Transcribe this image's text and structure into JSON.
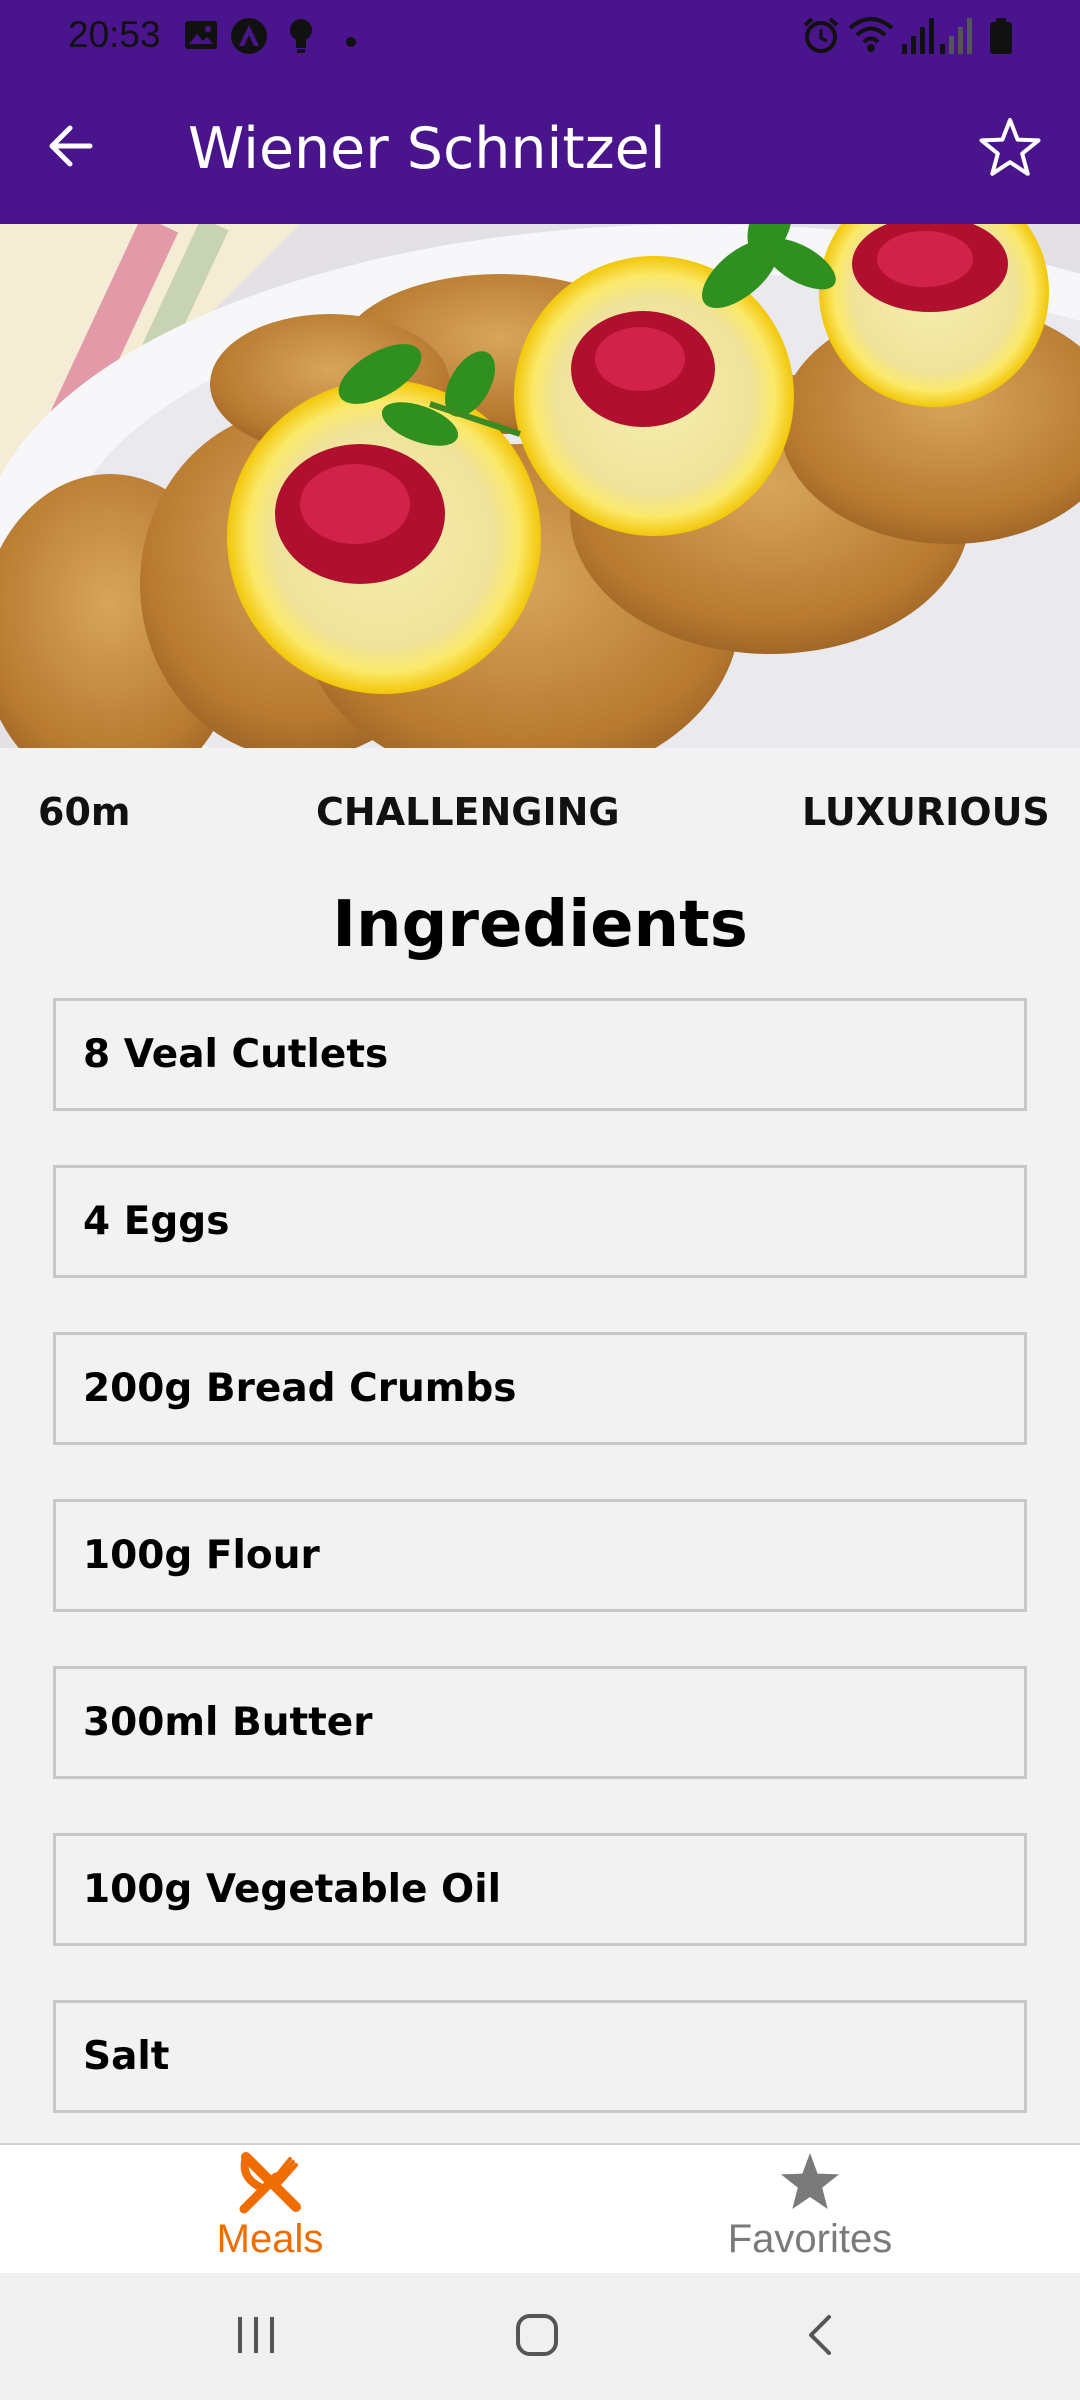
{
  "status_bar": {
    "time": "20:53",
    "left_icons": [
      "gallery-icon",
      "app-notification-icon",
      "bulb-icon",
      "dot-icon"
    ],
    "right_icons": [
      "alarm-icon",
      "wifi-icon",
      "signal-icon",
      "signal-icon",
      "battery-icon"
    ]
  },
  "app_bar": {
    "title": "Wiener Schnitzel",
    "back_icon": "arrow-back-icon",
    "favorite_icon": "star-outline-icon",
    "background": "#4a148c"
  },
  "meal": {
    "duration": "60m",
    "complexity": "CHALLENGING",
    "affordability": "LUXURIOUS"
  },
  "ingredients": {
    "title": "Ingredients",
    "items": [
      "8 Veal Cutlets",
      "4 Eggs",
      "200g Bread Crumbs",
      "100g Flour",
      "300ml Butter",
      "100g Vegetable Oil",
      "Salt"
    ]
  },
  "bottom_nav": {
    "tabs": [
      {
        "label": "Meals",
        "icon": "fork-knife-icon",
        "active": true
      },
      {
        "label": "Favorites",
        "icon": "star-icon",
        "active": false
      }
    ],
    "active_color": "#ef6c00",
    "inactive_color": "#7a7a7a"
  },
  "system_nav": {
    "buttons": [
      "recents-icon",
      "home-icon",
      "back-icon"
    ]
  }
}
